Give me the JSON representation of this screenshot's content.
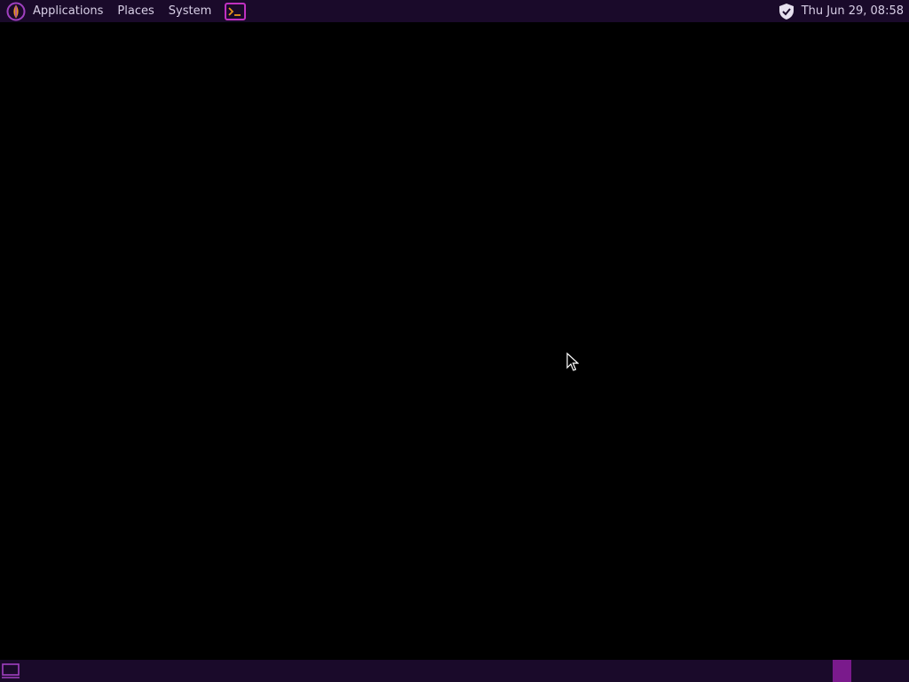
{
  "top_panel": {
    "menus": [
      {
        "label": "Applications"
      },
      {
        "label": "Places"
      },
      {
        "label": "System"
      }
    ],
    "launchers": [
      {
        "icon": "terminal-icon"
      }
    ],
    "tray": {
      "icons": [
        "shield-icon"
      ],
      "clock": "Thu Jun 29, 08:58"
    }
  },
  "bottom_panel": {
    "show_desktop_icon": "show-desktop-icon",
    "workspaces": {
      "count": 2,
      "active_index": 0
    }
  },
  "colors": {
    "panel_bg": "#1a0a2a",
    "desktop_bg": "#000000",
    "accent": "#a040c0",
    "accent_active": "#7a1a8c",
    "text": "#d8cfe6",
    "logo_orange": "#e8951c"
  }
}
